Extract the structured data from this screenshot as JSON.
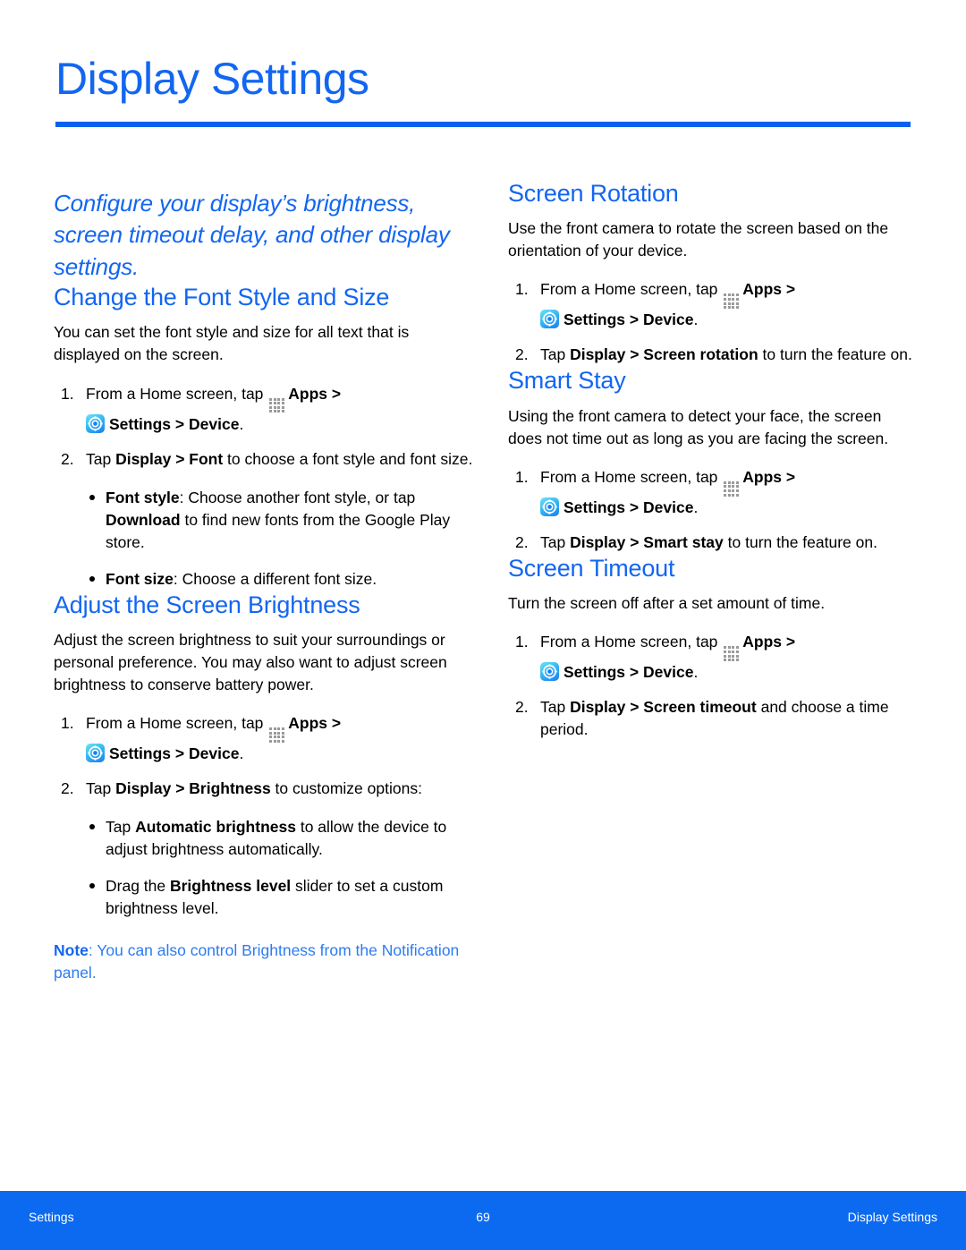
{
  "document": {
    "title": "Display Settings",
    "accent_color": "#1266F1",
    "rule_color": "#0661EE",
    "footer_bar_color": "#0B6AF0",
    "intro": "Configure your display’s brightness, screen timeout delay, and other display settings."
  },
  "icons": {
    "apps": "apps-grid-icon",
    "settings": "settings-gear-icon"
  },
  "left_column": {
    "font_section": {
      "heading": "Change the Font Style and Size",
      "intro": "You can set the font style and size for all text that is displayed on the screen.",
      "steps": [
        {
          "number": "1.",
          "pre_apps": "From a Home screen, tap",
          "apps_label": "Apps",
          "after_apps": ">",
          "settings_label": "Settings",
          "settings_sep": ">",
          "device_label": "Device",
          "end_punct": "."
        },
        {
          "number": "2.",
          "text_pre": "Tap ",
          "bold_1": "Display",
          "mid_1": " > ",
          "bold_2": "Font",
          "text_post": " to choose a font style and font size."
        }
      ],
      "bullets": [
        {
          "bold_1": "Font style",
          "text_1": ": Choose another font style, or tap ",
          "bold_2": "Download",
          "text_2": " to find new fonts from the Google Play store."
        },
        {
          "bold_1": "Font size",
          "text_1": ": Choose a different font size.",
          "bold_2": "",
          "text_2": ""
        }
      ]
    },
    "brightness_section": {
      "heading": "Adjust the Screen Brightness",
      "intro": "Adjust the screen brightness to suit your surroundings or personal preference. You may also want to adjust screen brightness to conserve battery power.",
      "steps": [
        {
          "number": "1.",
          "pre_apps": "From a Home screen, tap",
          "apps_label": "Apps",
          "after_apps": ">",
          "settings_label": "Settings",
          "settings_sep": ">",
          "device_label": "Device",
          "end_punct": "."
        },
        {
          "number": "2.",
          "text_pre": "Tap ",
          "bold_1": "Display",
          "mid_1": " > ",
          "bold_2": "Brightness",
          "text_post": " to customize options:"
        }
      ],
      "bullets": [
        {
          "bold_1": "Tap ",
          "text_1": "",
          "bold_2": "Automatic brightness",
          "text_2": " to allow the device to adjust brightness automatically."
        },
        {
          "bold_1": "Drag the ",
          "text_1": "",
          "bold_2": "Brightness level",
          "text_2": " slider to set a custom brightness level."
        }
      ],
      "note": {
        "label": "Note",
        "text": ": You can also control Brightness from the Notification panel."
      }
    }
  },
  "right_column": {
    "rotation_section": {
      "heading": "Screen Rotation",
      "intro": "Use the front camera to rotate the screen based on the orientation of your device.",
      "steps": [
        {
          "number": "1.",
          "pre_apps": "From a Home screen, tap",
          "apps_label": "Apps",
          "after_apps": ">",
          "settings_label": "Settings",
          "settings_sep": ">",
          "device_label": "Device",
          "end_punct": "."
        },
        {
          "number": "2.",
          "text_pre": "Tap ",
          "bold_1": "Display",
          "mid_1": " > ",
          "bold_2": "Screen rotation",
          "text_post": " to turn the feature on."
        }
      ]
    },
    "smart_stay_section": {
      "heading": "Smart Stay",
      "intro": "Using the front camera to detect your face, the screen does not time out as long as you are facing the screen.",
      "steps": [
        {
          "number": "1.",
          "pre_apps": "From a Home screen, tap",
          "apps_label": "Apps",
          "after_apps": ">",
          "settings_label": "Settings",
          "settings_sep": ">",
          "device_label": "Device",
          "end_punct": "."
        },
        {
          "number": "2.",
          "text_pre": "Tap ",
          "bold_1": "Display",
          "mid_1": " > ",
          "bold_2": "Smart stay",
          "text_post": " to turn the feature on."
        }
      ]
    },
    "timeout_section": {
      "heading": "Screen Timeout",
      "intro": "Turn the screen off after a set amount of time.",
      "steps": [
        {
          "number": "1.",
          "pre_apps": "From a Home screen, tap",
          "apps_label": "Apps",
          "after_apps": ">",
          "settings_label": "Settings",
          "settings_sep": ">",
          "device_label": "Device",
          "end_punct": "."
        },
        {
          "number": "2.",
          "text_pre": "Tap ",
          "bold_1": "Display",
          "mid_1": " > ",
          "bold_2": "Screen timeout",
          "text_post": " and choose a time period."
        }
      ]
    }
  },
  "footer": {
    "left": "Settings",
    "page_number": "69",
    "right": "Display Settings"
  }
}
